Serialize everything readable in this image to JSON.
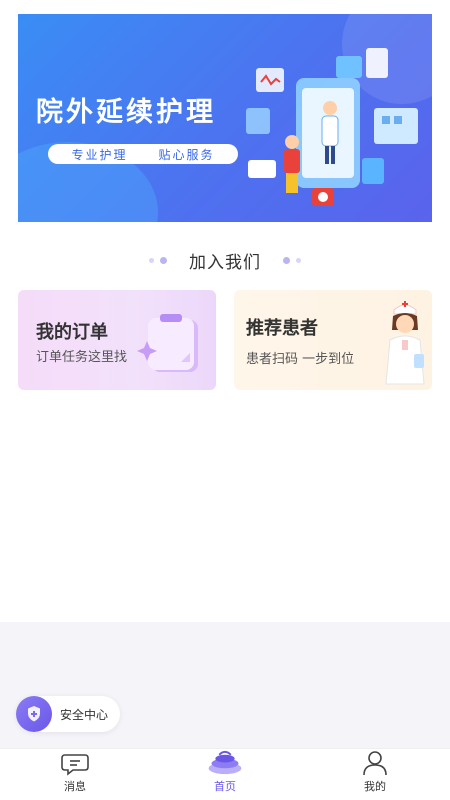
{
  "banner": {
    "title": "院外延续护理",
    "tag_left": "专业护理",
    "tag_right": "贴心服务"
  },
  "section": {
    "title": "加入我们"
  },
  "cards": {
    "orders": {
      "title": "我的订单",
      "subtitle": "订单任务这里找",
      "icon": "clipboard-icon"
    },
    "recommend": {
      "title": "推荐患者",
      "subtitle": "患者扫码 一步到位",
      "icon": "nurse-illustration"
    }
  },
  "safety": {
    "label": "安全中心",
    "icon": "shield-icon"
  },
  "tabs": [
    {
      "label": "消息",
      "icon": "message-icon",
      "active": false
    },
    {
      "label": "首页",
      "icon": "home-icon",
      "active": true
    },
    {
      "label": "我的",
      "icon": "user-icon",
      "active": false
    }
  ],
  "colors": {
    "accent": "#6a57e8",
    "banner": "#4d72f0"
  }
}
